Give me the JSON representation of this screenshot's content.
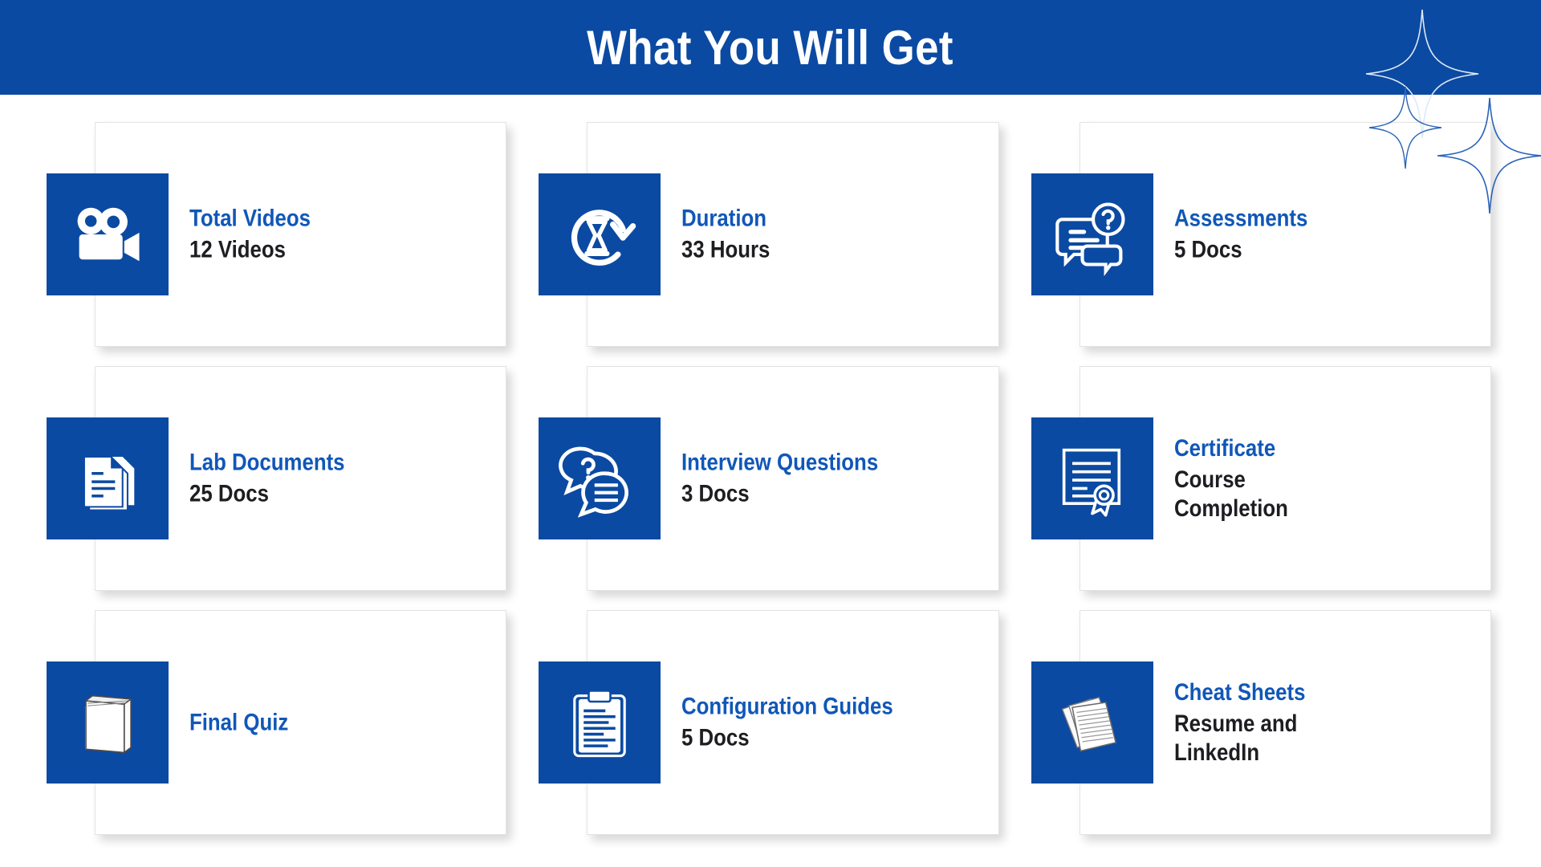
{
  "header": {
    "title": "What You Will Get",
    "bg_color": "#0b4aa2",
    "text_color": "#ffffff"
  },
  "theme": {
    "accent_blue": "#0b4aa2",
    "title_blue": "#1057b8",
    "value_dark": "#1e1e22",
    "card_bg": "#ffffff",
    "page_bg": "#ffffff"
  },
  "decor": {
    "sparkle_count": 3,
    "sparkle_color": "#2a63b8"
  },
  "cards": [
    {
      "icon": "video-camera-icon",
      "title": "Total Videos",
      "value": "12 Videos"
    },
    {
      "icon": "hourglass-refresh-icon",
      "title": "Duration",
      "value": "33 Hours"
    },
    {
      "icon": "chat-question-icon",
      "title": "Assessments",
      "value": "5 Docs"
    },
    {
      "icon": "document-stack-icon",
      "title": "Lab Documents",
      "value": "25 Docs"
    },
    {
      "icon": "speech-bubbles-icon",
      "title": "Interview Questions",
      "value": "3 Docs"
    },
    {
      "icon": "certificate-ribbon-icon",
      "title": "Certificate",
      "value": "Course\nCompletion"
    },
    {
      "icon": "book-icon",
      "title": "Final Quiz",
      "value": ""
    },
    {
      "icon": "clipboard-icon",
      "title": "Configuration Guides",
      "value": "5 Docs"
    },
    {
      "icon": "paper-sheets-icon",
      "title": "Cheat Sheets",
      "value": "Resume and\nLinkedIn"
    }
  ]
}
